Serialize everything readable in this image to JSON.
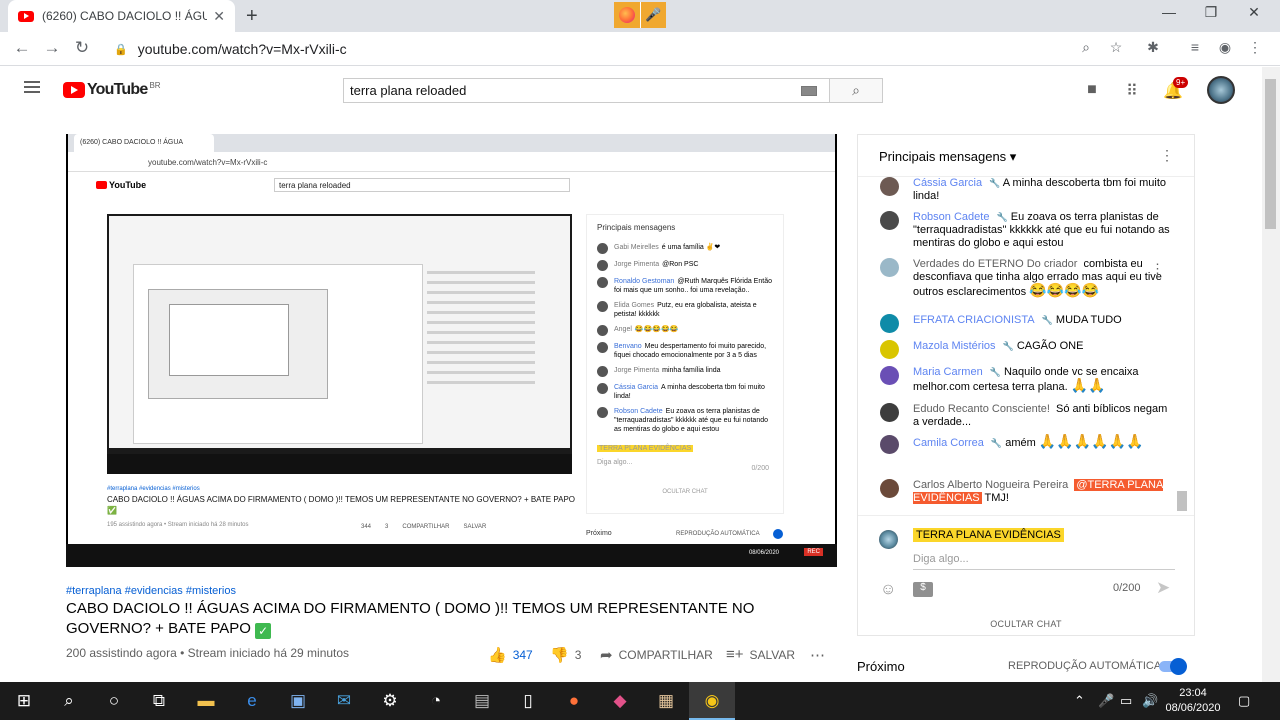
{
  "browser": {
    "tab_title": "(6260) CABO DACIOLO !! ÁGUAS",
    "tab_close": "✕",
    "new_tab": "+",
    "url": "youtube.com/watch?v=Mx-rVxili-c"
  },
  "youtube": {
    "logo_word": "YouTube",
    "logo_region": "BR",
    "search_value": "terra plana reloaded",
    "notification_count": "9+"
  },
  "video": {
    "inner_tab": "(6260) CABO DACIOLO !! ÁGUA",
    "inner_url": "youtube.com/watch?v=Mx-rVxili-c",
    "inner_search": "terra plana reloaded",
    "inner_logo": "YouTube",
    "inner_chat_title": "Principais mensagens",
    "inner_chat_rows": [
      {
        "name": "Gabi Meirelles",
        "text": "é uma família ✌❤"
      },
      {
        "name": "Jorge Pimenta",
        "text": "@Ron PSC"
      },
      {
        "name": "Ronaldo Gestoman",
        "text": "@Ruth Marquês Flórida Então foi mais que um sonho.. foi uma revelação.."
      },
      {
        "name": "Elida Gomes",
        "text": "Putz, eu era globalista, ateista e petista! kkkkkk"
      },
      {
        "name": "Angel",
        "text": "😂😂😂😂😂"
      },
      {
        "name": "Benvano",
        "text": "Meu despertamento foi muito parecido, fiquei chocado emocionalmente por 3 a 5 dias"
      },
      {
        "name": "Jorge Pimenta",
        "text": "minha família linda"
      },
      {
        "name": "Cássia Garcia",
        "text": "A minha descoberta tbm foi muito linda!"
      },
      {
        "name": "Robson Cadete",
        "text": "Eu zoava os terra planistas de \"terraquadradistas\" kkkkkk até que eu fui notando as mentiras do globo e aqui estou"
      }
    ],
    "inner_user": "TERRA PLANA EVIDÊNCIAS",
    "inner_placeholder": "Diga algo...",
    "inner_counter": "0/200",
    "inner_hide_chat": "OCULTAR CHAT",
    "inner_hashtags": "#terraplana #evidencias #misterios",
    "inner_title": "CABO DACIOLO !! ÁGUAS ACIMA DO FIRMAMENTO ( DOMO )!! TEMOS UM REPRESENTANTE NO GOVERNO? + BATE PAPO ✅",
    "inner_meta": "195 assistindo agora • Stream iniciado há 28 minutos",
    "inner_likes": "344",
    "inner_dislikes": "3",
    "inner_share": "COMPARTILHAR",
    "inner_save": "SALVAR",
    "inner_next": "Próximo",
    "inner_autoplay": "REPRODUÇÃO AUTOMÁTICA",
    "inner_clock": "08/06/2020",
    "inner_rec": "REC"
  },
  "info": {
    "hashtags": "#terraplana #evidencias #misterios",
    "title": "CABO DACIOLO !! ÁGUAS ACIMA DO FIRMAMENTO ( DOMO )!! TEMOS UM REPRESENTANTE NO GOVERNO? + BATE PAPO",
    "title_emoji": "✓",
    "viewers": "200 assistindo agora",
    "separator": "•",
    "started": "Stream iniciado há 29 minutos",
    "likes": "347",
    "dislikes": "3",
    "share_label": "COMPARTILHAR",
    "save_label": "SALVAR"
  },
  "chat": {
    "header": "Principais mensagens",
    "messages": [
      {
        "name": "Cássia Garcia",
        "moderator": true,
        "text": "A minha descoberta tbm foi muito linda!",
        "avatar_color": "#6d5a53"
      },
      {
        "name": "Robson Cadete",
        "moderator": true,
        "text": "Eu zoava os terra planistas de \"terraquadradistas\" kkkkkk até que eu fui notando as mentiras do globo e aqui estou",
        "avatar_color": "#4a4a4a"
      },
      {
        "name": "Verdades do ETERNO Do criador",
        "moderator": false,
        "text": "combista eu desconfiava que tinha algo errado mas aqui eu tive outros esclarecimentos",
        "emojis": "😂😂😂😂",
        "avatar_color": "#9ab8c8"
      },
      {
        "name": "EFRATA CRIACIONISTA",
        "moderator": true,
        "text": "MUDA TUDO",
        "avatar_color": "#0f8ba8"
      },
      {
        "name": "Mazola Mistérios",
        "moderator": true,
        "text": "CAGÃO ONE",
        "avatar_color": "#d9c500"
      },
      {
        "name": "Maria Carmen",
        "moderator": true,
        "text": "Naquilo onde vc se encaixa melhor.com certesa terra plana.",
        "emojis": "🙏🙏",
        "avatar_color": "#6a4fb5"
      },
      {
        "name": "Edudo Recanto Consciente!",
        "moderator": false,
        "text": "Só anti bíblicos negam a verdade...",
        "avatar_color": "#3d3d3d"
      },
      {
        "name": "Camila Correa",
        "moderator": true,
        "text": "amém",
        "emojis": "🙏🙏🙏🙏🙏🙏",
        "avatar_color": "#5a4a6a"
      },
      {
        "name": "Carlos Alberto Nogueira Pereira",
        "moderator": false,
        "mention": "@TERRA PLANA EVIDÊNCIAS",
        "text": "TMJ!",
        "avatar_color": "#6b4a3a"
      }
    ],
    "user_name": "TERRA PLANA EVIDÊNCIAS",
    "input_placeholder": "Diga algo...",
    "counter": "0/200",
    "money_symbol": "$",
    "hide_chat": "OCULTAR CHAT"
  },
  "autoplay": {
    "next_label": "Próximo",
    "autoplay_label": "REPRODUÇÃO AUTOMÁTICA",
    "enabled": true
  },
  "taskbar": {
    "time": "23:04",
    "date": "08/06/2020"
  },
  "colors": {
    "youtube_red": "#ff0000",
    "link_blue": "#065fd4",
    "moderator_blue": "#5e84f1",
    "chat_user_badge": "#fbd62a",
    "mention_highlight": "#f55b2f"
  }
}
